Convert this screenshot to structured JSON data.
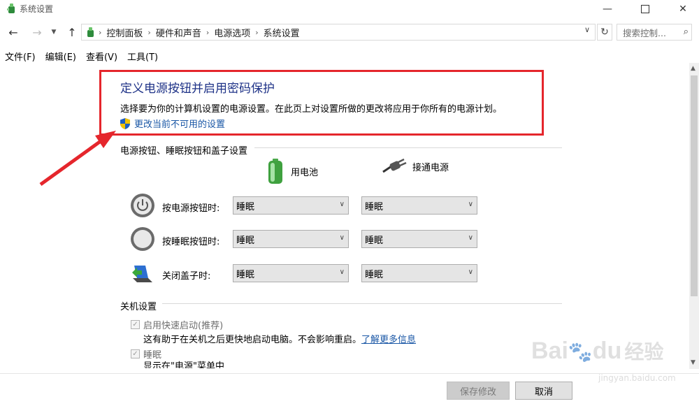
{
  "window": {
    "title": "系统设置",
    "minimize_icon": "minimize-icon",
    "maximize_icon": "maximize-icon",
    "close_icon": "close-icon"
  },
  "nav": {
    "breadcrumbs": [
      "控制面板",
      "硬件和声音",
      "电源选项",
      "系统设置"
    ],
    "search_placeholder": "搜索控制..."
  },
  "menu": [
    "文件(F)",
    "编辑(E)",
    "查看(V)",
    "工具(T)"
  ],
  "main": {
    "heading": "定义电源按钮并启用密码保护",
    "description": "选择要为你的计算机设置的电源设置。在此页上对设置所做的更改将应用于你所有的电源计划。",
    "change_link": "更改当前不可用的设置",
    "section_buttons": "电源按钮、睡眠按钮和盖子设置",
    "col_battery": "用电池",
    "col_plugged": "接通电源",
    "rows": [
      {
        "label": "按电源按钮时:",
        "battery": "睡眠",
        "plugged": "睡眠"
      },
      {
        "label": "按睡眠按钮时:",
        "battery": "睡眠",
        "plugged": "睡眠"
      },
      {
        "label": "关闭盖子时:",
        "battery": "睡眠",
        "plugged": "睡眠"
      }
    ],
    "section_shutdown": "关机设置",
    "fast_startup": "启用快速启动(推荐)",
    "fast_startup_note": "这有助于在关机之后更快地启动电脑。不会影响重启。",
    "learn_more": "了解更多信息",
    "sleep": "睡眠",
    "sleep_note": "显示在\"电源\"菜单中"
  },
  "footer": {
    "save": "保存修改",
    "cancel": "取消"
  },
  "watermark": {
    "brand": "Bai",
    "brand2": "du",
    "cn": "经验",
    "url": "jingyan.baidu.com"
  },
  "colors": {
    "highlight_border": "#e5262c",
    "heading": "#1e3287",
    "link": "#1a57a6"
  }
}
